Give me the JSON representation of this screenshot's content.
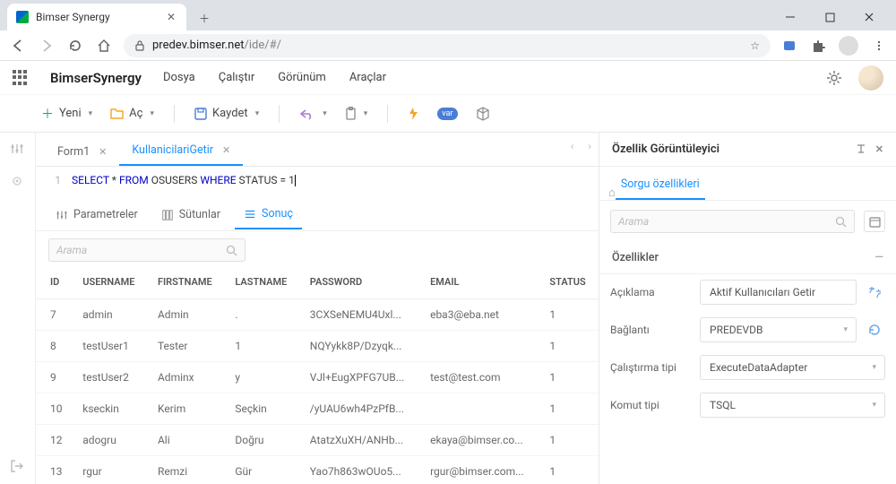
{
  "browser": {
    "tab_title": "Bimser Synergy",
    "url_host": "predev.bimser.net",
    "url_path": "/ide/#/"
  },
  "app": {
    "name": "BimserSynergy",
    "menu": [
      "Dosya",
      "Çalıştır",
      "Görünüm",
      "Araçlar"
    ]
  },
  "toolbar": {
    "new": "Yeni",
    "open": "Aç",
    "save": "Kaydet"
  },
  "tabs": [
    {
      "label": "Form1",
      "active": false
    },
    {
      "label": "KullanicilariGetir",
      "active": true
    }
  ],
  "editor": {
    "line_no": "1",
    "tokens": {
      "select": "SELECT",
      "star": "*",
      "from": "FROM",
      "table": "OSUSERS",
      "where": "WHERE",
      "col": "STATUS",
      "eq": "=",
      "val": "1"
    }
  },
  "result_tabs": [
    "Parametreler",
    "Sütunlar",
    "Sonuç"
  ],
  "search_ph": "Arama",
  "table": {
    "headers": [
      "ID",
      "USERNAME",
      "FIRSTNAME",
      "LASTNAME",
      "PASSWORD",
      "EMAIL",
      "STATUS"
    ],
    "rows": [
      [
        "7",
        "admin",
        "Admin",
        ".",
        "3CXSeNEMU4Uxl...",
        "eba3@eba.net",
        "1"
      ],
      [
        "8",
        "testUser1",
        "Tester",
        "1",
        "NQYykk8P/Dzyqk...",
        "",
        "1"
      ],
      [
        "9",
        "testUser2",
        "Adminx",
        "y",
        "VJl+EugXPFG7UB...",
        "test@test.com",
        "1"
      ],
      [
        "10",
        "kseckin",
        "Kerim",
        "Seçkin",
        "/yUAU6wh4PzPfB...",
        "",
        "1"
      ],
      [
        "12",
        "adogru",
        "Ali",
        "Doğru",
        "AtatzXuXH/ANHb...",
        "ekaya@bimser.co...",
        "1"
      ],
      [
        "13",
        "rgur",
        "Remzi",
        "Gür",
        "Yao7h863wOUo5...",
        "rgur@bimser.com...",
        "1"
      ]
    ]
  },
  "right": {
    "title": "Özellik Görüntüleyici",
    "subtab": "Sorgu özellikleri",
    "search_ph": "Arama",
    "section": "Özellikler",
    "props": {
      "aciklama_label": "Açıklama",
      "aciklama_value": "Aktif Kullanıcıları Getir",
      "baglanti_label": "Bağlantı",
      "baglanti_value": "PREDEVDB",
      "calistirma_label": "Çalıştırma tipi",
      "calistirma_value": "ExecuteDataAdapter",
      "komut_label": "Komut tipi",
      "komut_value": "TSQL"
    }
  }
}
